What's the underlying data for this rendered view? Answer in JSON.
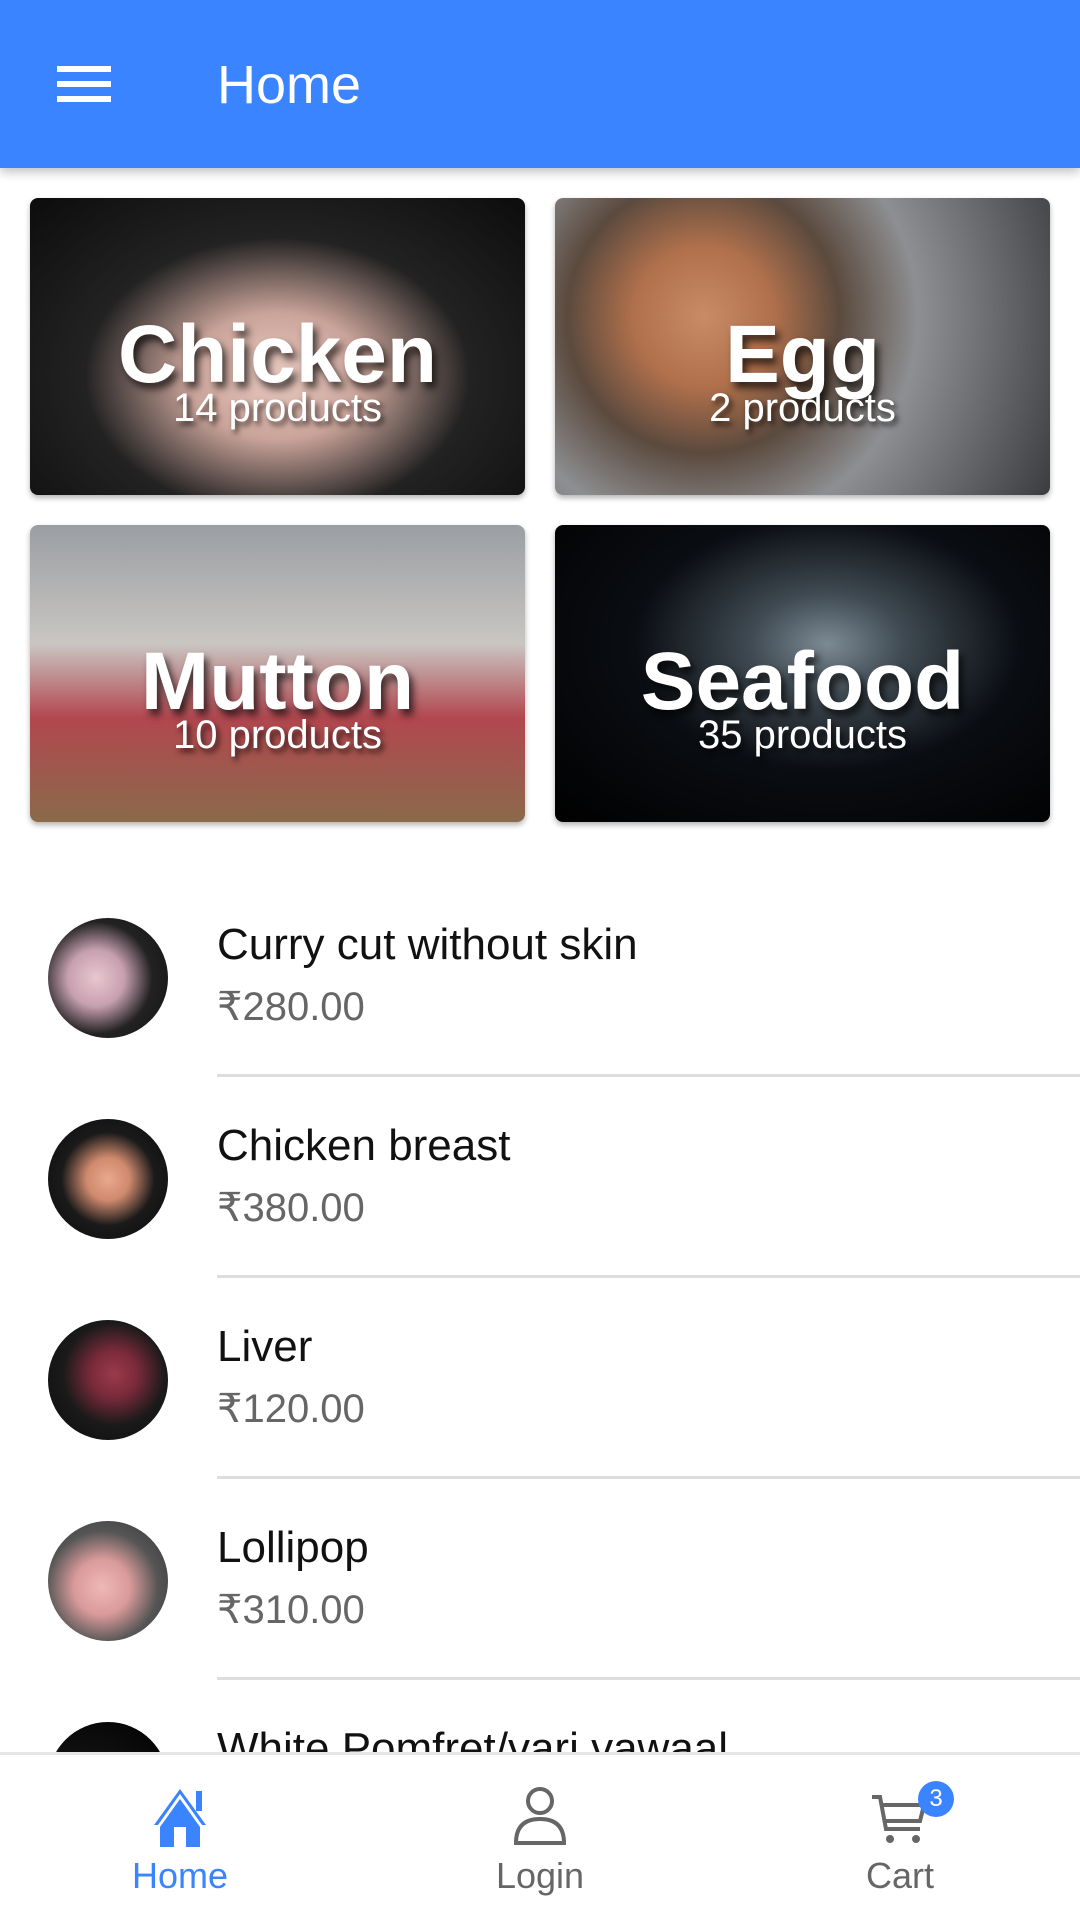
{
  "header": {
    "title": "Home",
    "menu_icon": "hamburger-menu-icon"
  },
  "categories": [
    {
      "name": "Chicken",
      "count": "14 products"
    },
    {
      "name": "Egg",
      "count": "2 products"
    },
    {
      "name": "Mutton",
      "count": "10 products"
    },
    {
      "name": "Seafood",
      "count": "35 products"
    }
  ],
  "products": [
    {
      "name": "Curry cut without skin",
      "price": "₹280.00"
    },
    {
      "name": "Chicken breast",
      "price": "₹380.00"
    },
    {
      "name": "Liver",
      "price": "₹120.00"
    },
    {
      "name": "Lollipop",
      "price": "₹310.00"
    },
    {
      "name": "White Pomfret/vari vawaal",
      "price": ""
    }
  ],
  "nav": {
    "home": "Home",
    "login": "Login",
    "cart": "Cart",
    "cart_count": "3",
    "active_color": "#3a84ff"
  }
}
